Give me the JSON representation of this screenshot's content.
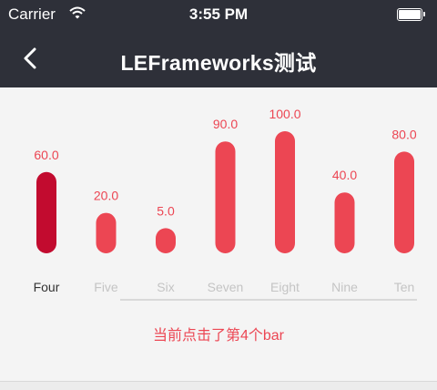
{
  "status_bar": {
    "carrier": "Carrier",
    "time": "3:55 PM",
    "wifi_icon": "wifi-icon",
    "battery_icon": "battery-icon"
  },
  "nav": {
    "title": "LEFrameworks测试",
    "back_icon": "chevron-left-icon"
  },
  "colors": {
    "header_bg": "#2e3039",
    "bar": "#ec4653",
    "bar_selected": "#c20b2f",
    "value_label": "#ec4653",
    "category_label": "#c4c4c4",
    "category_label_selected": "#333333",
    "baseline": "#d9d9d9",
    "message": "#ec4653"
  },
  "chart_data": {
    "type": "bar",
    "categories": [
      "Four",
      "Five",
      "Six",
      "Seven",
      "Eight",
      "Nine",
      "Ten"
    ],
    "values": [
      60.0,
      20.0,
      5.0,
      90.0,
      100.0,
      40.0,
      80.0
    ],
    "value_labels": [
      "60.0",
      "20.0",
      "5.0",
      "90.0",
      "100.0",
      "40.0",
      "80.0"
    ],
    "selected_index": 0,
    "title": "",
    "xlabel": "",
    "ylabel": ""
  },
  "message": "当前点击了第4个bar"
}
